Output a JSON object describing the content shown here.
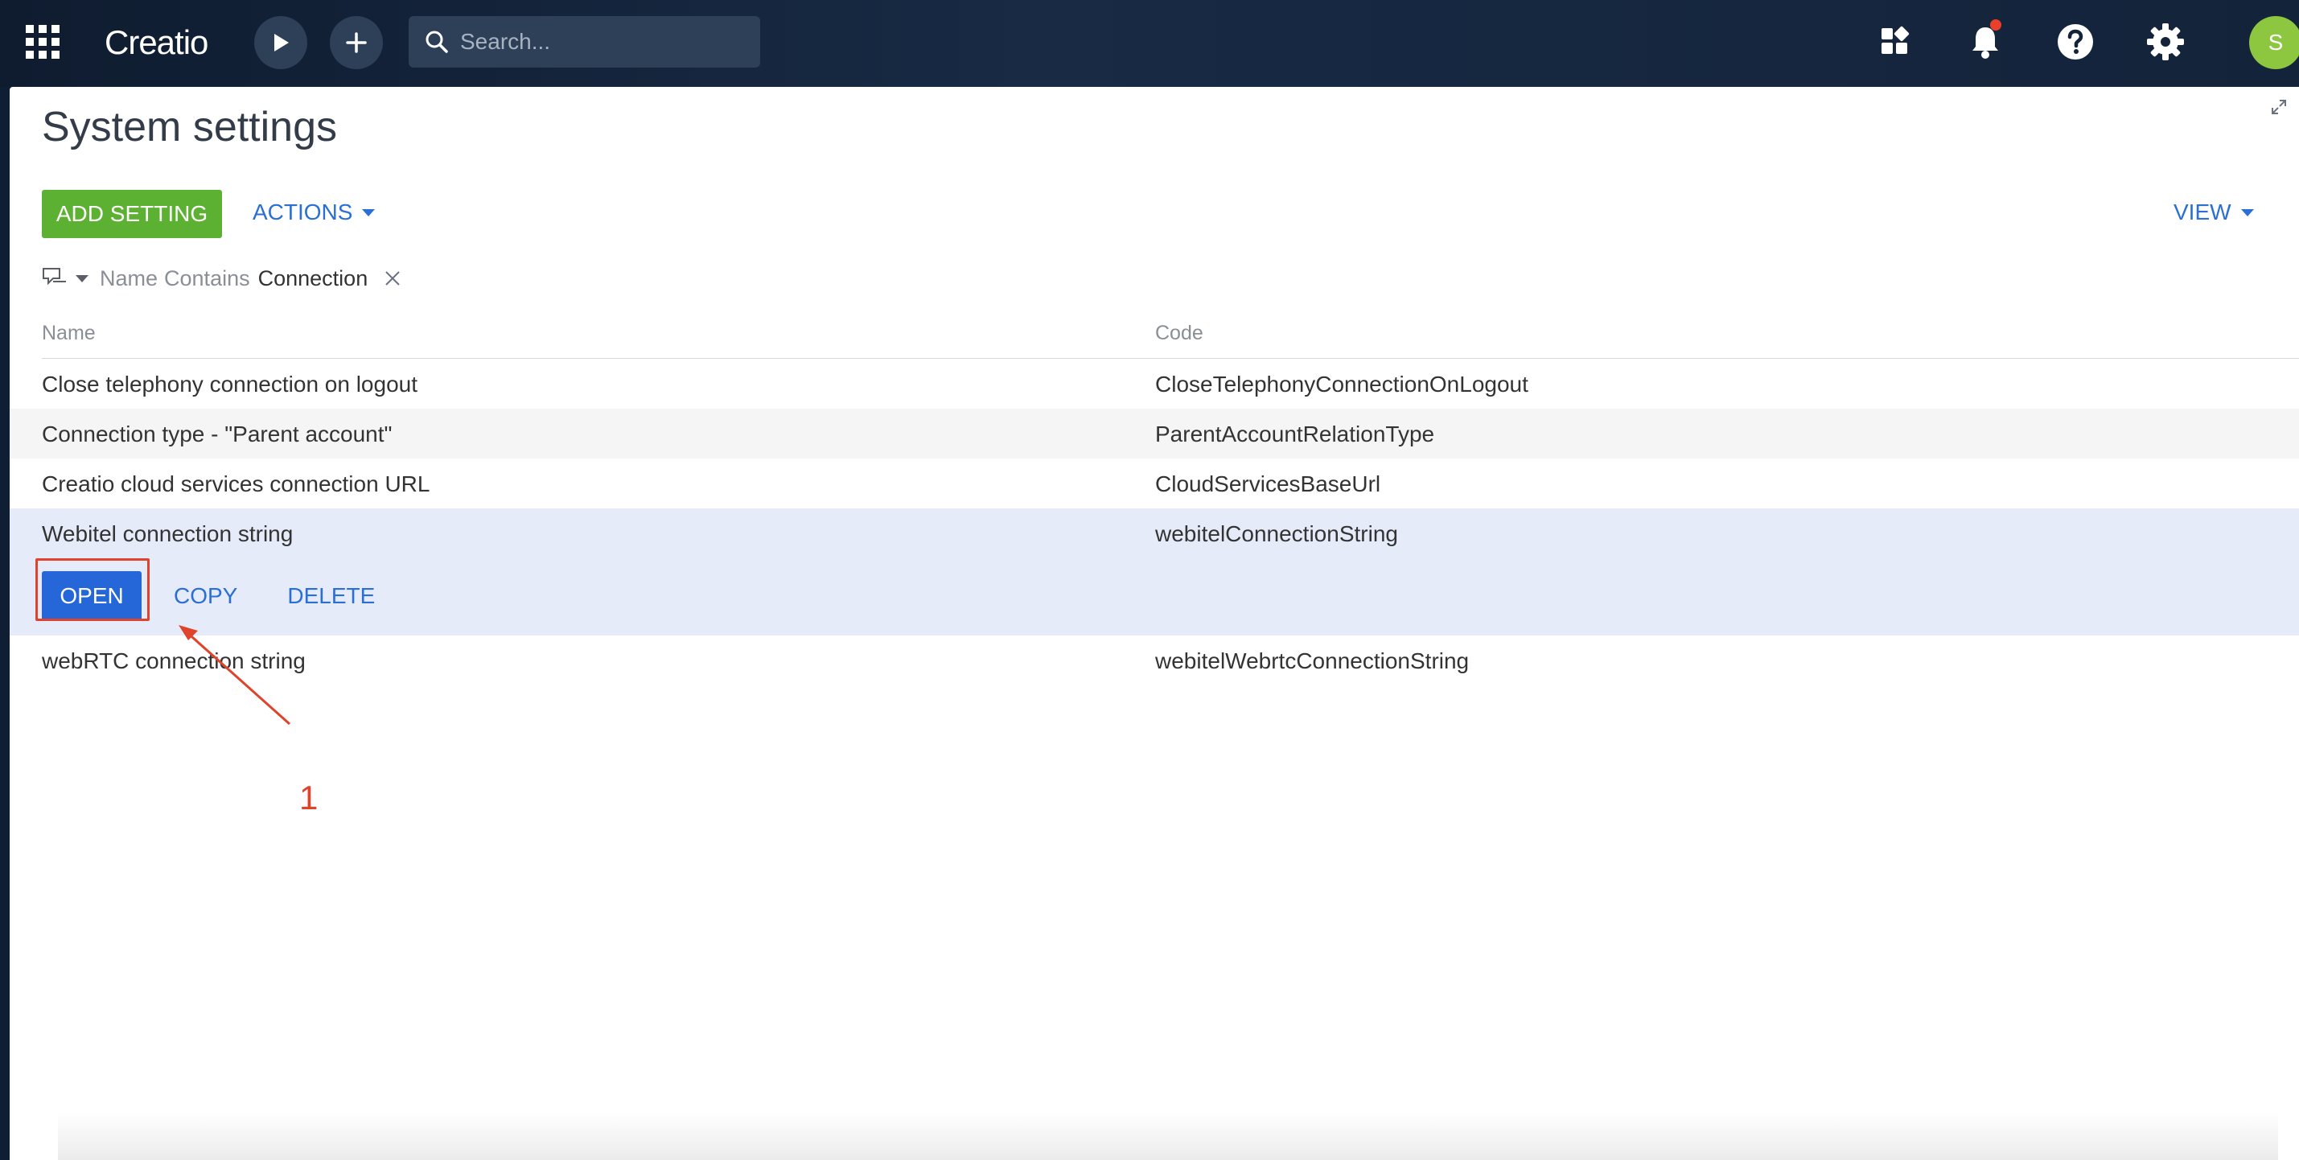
{
  "topbar": {
    "logo": "Creatio",
    "search_placeholder": "Search...",
    "avatar_initial": "S"
  },
  "page": {
    "title": "System settings"
  },
  "toolbar": {
    "add_label": "ADD SETTING",
    "actions_label": "ACTIONS",
    "view_label": "VIEW"
  },
  "filter": {
    "field": "Name",
    "operator": "Contains",
    "value": "Connection"
  },
  "grid": {
    "columns": [
      "Name",
      "Code"
    ],
    "rows": [
      {
        "name": "Close telephony connection on logout",
        "code": "CloseTelephonyConnectionOnLogout"
      },
      {
        "name": "Connection type - \"Parent account\"",
        "code": "ParentAccountRelationType"
      },
      {
        "name": "Creatio cloud services connection URL",
        "code": "CloudServicesBaseUrl"
      },
      {
        "name": "Webitel connection string",
        "code": "webitelConnectionString"
      },
      {
        "name": "webRTC connection string",
        "code": "webitelWebrtcConnectionString"
      }
    ],
    "row_actions": {
      "open": "OPEN",
      "copy": "COPY",
      "delete": "DELETE"
    }
  },
  "annotation": {
    "number": "1"
  },
  "colors": {
    "topbar": "#13233a",
    "add_button": "#5db132",
    "open_button": "#2566d9",
    "link": "#2a6fd6",
    "selected_row": "#e5ebf8",
    "annotation": "#e0432b",
    "avatar": "#8dc63f"
  }
}
